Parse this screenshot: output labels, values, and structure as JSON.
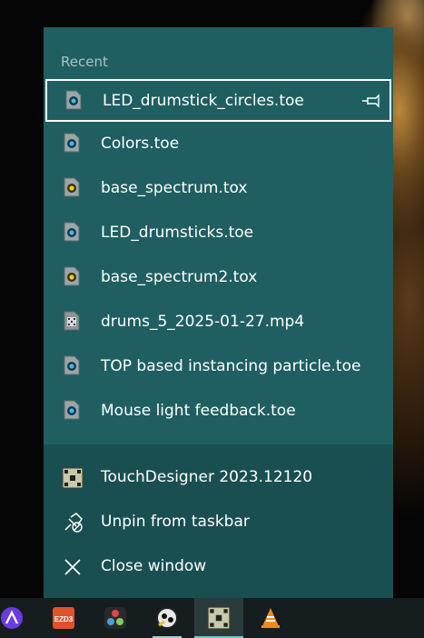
{
  "jumplist": {
    "recent_title": "Recent",
    "recent_items": [
      {
        "label": "LED_drumstick_circles.toe",
        "icon": "toe-file-icon",
        "selected": true
      },
      {
        "label": "Colors.toe",
        "icon": "toe-file-icon"
      },
      {
        "label": "base_spectrum.tox",
        "icon": "tox-file-icon"
      },
      {
        "label": "LED_drumsticks.toe",
        "icon": "toe-file-icon"
      },
      {
        "label": "base_spectrum2.tox",
        "icon": "tox-file-icon"
      },
      {
        "label": "drums_5_2025-01-27.mp4",
        "icon": "video-file-icon"
      },
      {
        "label": "TOP based instancing particle.toe",
        "icon": "toe-file-icon"
      },
      {
        "label": "Mouse light feedback.toe",
        "icon": "toe-file-icon"
      }
    ],
    "tasks": [
      {
        "label": "TouchDesigner 2023.12120",
        "icon": "touchdesigner-icon"
      },
      {
        "label": "Unpin from taskbar",
        "icon": "unpin-icon"
      },
      {
        "label": "Close window",
        "icon": "close-icon"
      }
    ]
  },
  "taskbar": {
    "apps": [
      {
        "name": "arc-app-icon"
      },
      {
        "name": "ezd3-app-icon",
        "label": "EZD3"
      },
      {
        "name": "davinci-resolve-app-icon"
      },
      {
        "name": "touchdesigner-alt-app-icon"
      },
      {
        "name": "touchdesigner-app-icon",
        "active": true
      },
      {
        "name": "vlc-app-icon"
      }
    ]
  },
  "colors": {
    "jumplist_bg": "#1f5f61",
    "tasks_bg": "#1a4f51",
    "taskbar_bg": "#161d1f",
    "accent": "#76c6c6"
  }
}
